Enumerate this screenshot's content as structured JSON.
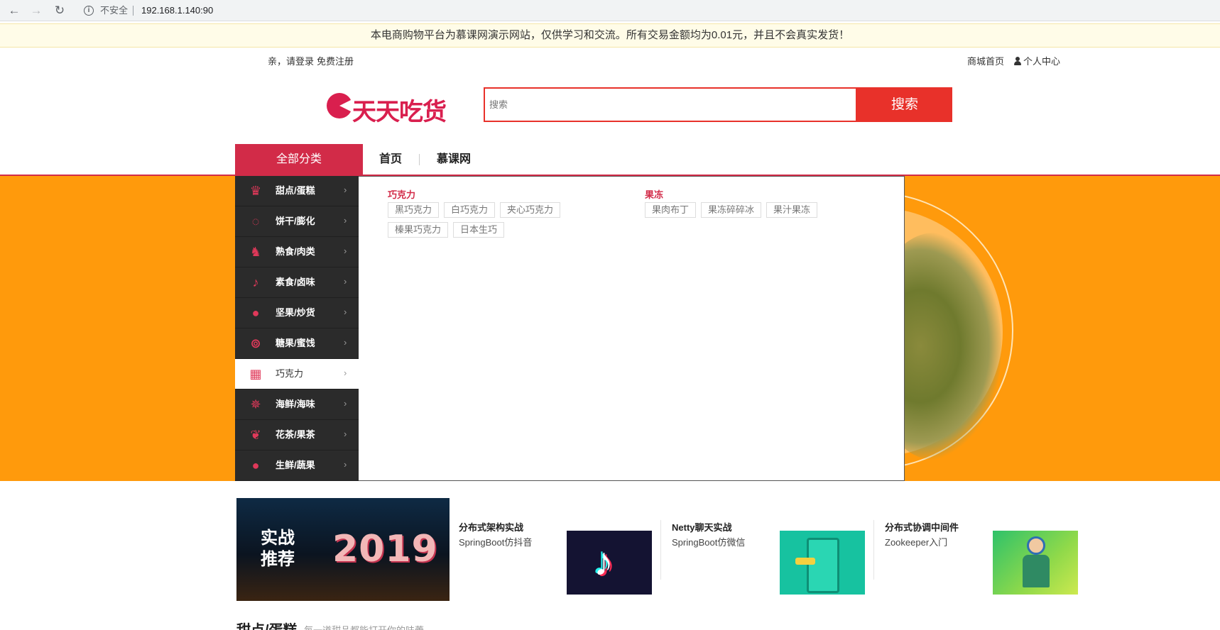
{
  "browser": {
    "security": "不安全",
    "url": "192.168.1.140:90"
  },
  "notice": "本电商购物平台为慕课网演示网站，仅供学习和交流。所有交易金额均为0.01元，并且不会真实发货！",
  "top_bar": {
    "greeting": "亲，请登录",
    "register": "免费注册",
    "mall_home": "商城首页",
    "user_center": "个人中心"
  },
  "logo": {
    "text": "天天吃货"
  },
  "search": {
    "placeholder": "搜索",
    "button": "搜索"
  },
  "nav": {
    "all_categories": "全部分类",
    "home": "首页",
    "mooc": "慕课网"
  },
  "categories": [
    {
      "label": "甜点/蛋糕",
      "icon": "cupcake-icon"
    },
    {
      "label": "饼干/膨化",
      "icon": "cookie-icon"
    },
    {
      "label": "熟食/肉类",
      "icon": "pig-icon"
    },
    {
      "label": "素食/卤味",
      "icon": "drumstick-icon"
    },
    {
      "label": "坚果/炒货",
      "icon": "nut-icon"
    },
    {
      "label": "糖果/蜜饯",
      "icon": "lollipop-icon"
    },
    {
      "label": "巧克力",
      "icon": "chocolate-icon",
      "active": true
    },
    {
      "label": "海鲜/海味",
      "icon": "lobster-icon"
    },
    {
      "label": "花茶/果茶",
      "icon": "leaf-icon"
    },
    {
      "label": "生鲜/蔬果",
      "icon": "tomato-icon"
    }
  ],
  "sub_menu": {
    "group1": {
      "title": "巧克力",
      "tags": [
        "黑巧克力",
        "白巧克力",
        "夹心巧克力",
        "榛果巧克力",
        "日本生巧"
      ]
    },
    "group2": {
      "title": "果冻",
      "tags": [
        "果肉布丁",
        "果冻碎碎冰",
        "果汁果冻"
      ]
    }
  },
  "recommend": {
    "main_title": "实战推荐",
    "main_year": "2019",
    "cards": [
      {
        "title": "分布式架构实战",
        "subtitle": "SpringBoot仿抖音"
      },
      {
        "title": "Netty聊天实战",
        "subtitle": "SpringBoot仿微信"
      },
      {
        "title": "分布式协调中间件",
        "subtitle": "Zookeeper入门"
      }
    ]
  },
  "section": {
    "title": "甜点/蛋糕",
    "subtitle": "每一道甜品都能打开你的味蕾"
  },
  "colors": {
    "brand_red": "#d22b48",
    "search_red": "#e8312a",
    "banner_orange": "#ff9a0c",
    "sidebar_dark": "#2b2b2b"
  }
}
